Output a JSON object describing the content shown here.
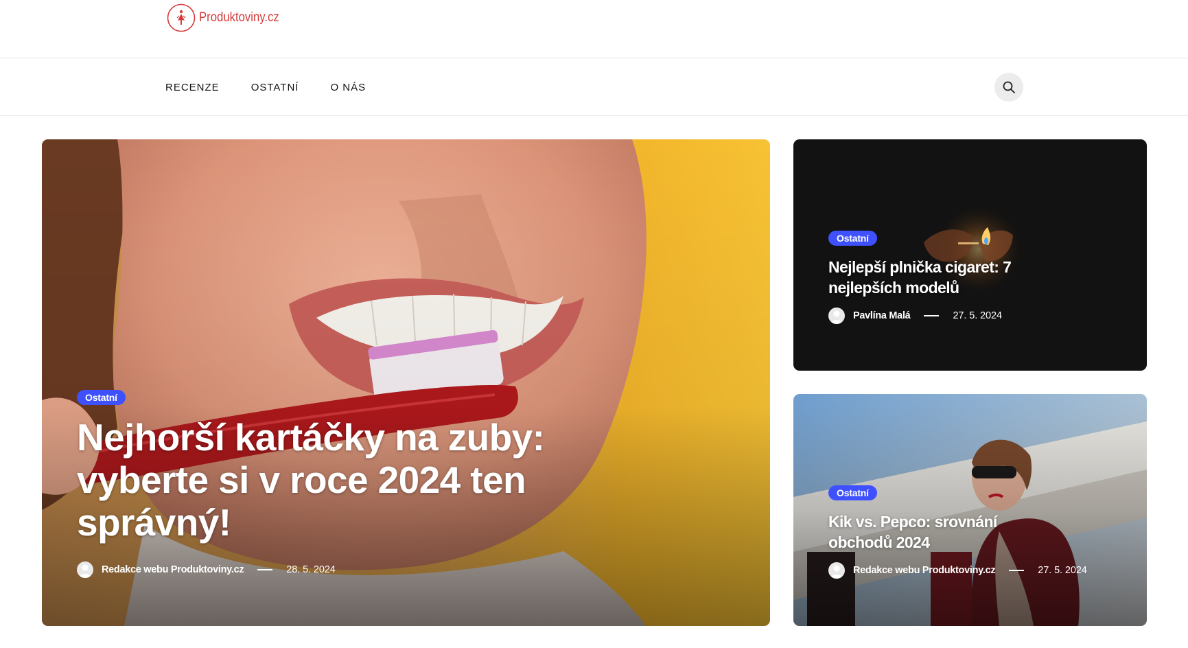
{
  "site": {
    "logo_text": "Produktoviny.cz",
    "brand_color": "#d63a3a"
  },
  "nav": {
    "items": [
      {
        "label": "RECENZE"
      },
      {
        "label": "OSTATNÍ"
      },
      {
        "label": "O NÁS"
      }
    ],
    "search_icon": "search-icon"
  },
  "featured": {
    "main": {
      "category": "Ostatní",
      "title": "Nejhorší kartáčky na zuby: vyberte si v roce 2024 ten správný!",
      "author": "Redakce webu Produktoviny.cz",
      "date": "28. 5. 2024"
    },
    "side": [
      {
        "category": "Ostatní",
        "title": "Nejlepší plnička cigaret: 7 nejlepších modelů",
        "author": "Pavlína Malá",
        "date": "27. 5. 2024"
      },
      {
        "category": "Ostatní",
        "title": "Kik vs. Pepco: srovnání obchodů 2024",
        "author": "Redakce webu Produktoviny.cz",
        "date": "27. 5. 2024"
      }
    ]
  },
  "colors": {
    "badge": "#3f51ff",
    "text_dark": "#111111"
  }
}
